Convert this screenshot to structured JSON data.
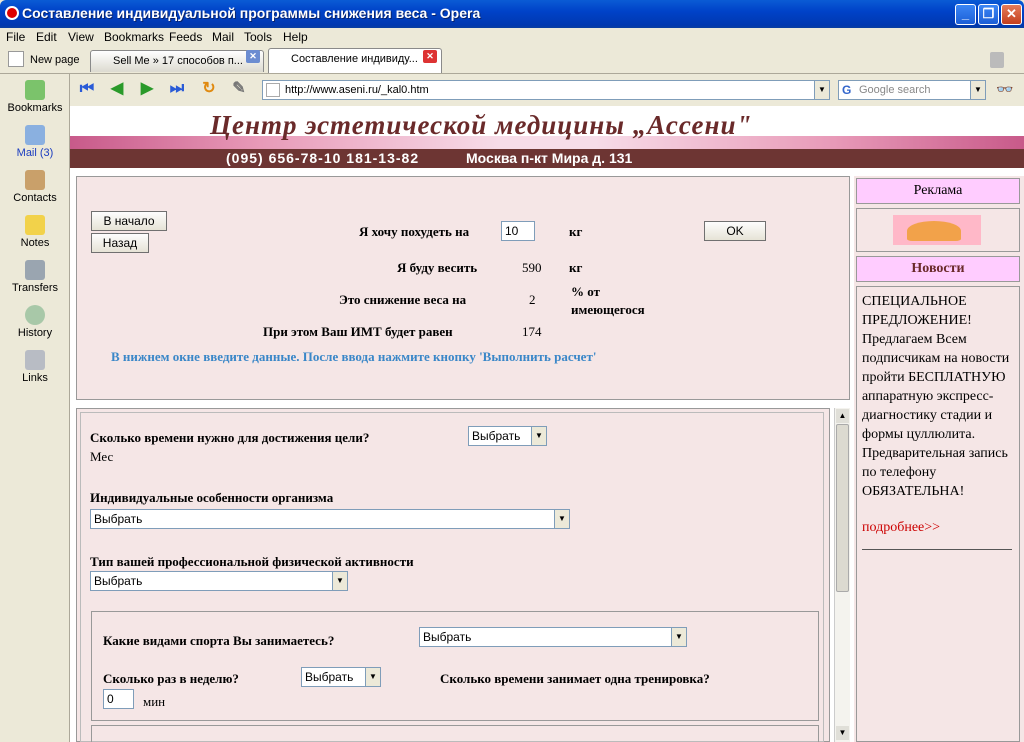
{
  "window": {
    "title": "Составление индивидуальной программы снижения веса - Opera"
  },
  "menu": [
    "File",
    "Edit",
    "View",
    "Bookmarks",
    "Feeds",
    "Mail",
    "Tools",
    "Help"
  ],
  "tabs": {
    "new_page": "New page",
    "items": [
      {
        "label": "Sell Me » 17 способов п..."
      },
      {
        "label": "Составление индивиду..."
      }
    ]
  },
  "nav": {
    "url": "http://www.aseni.ru/_kal0.htm",
    "search_placeholder": "Google search"
  },
  "sidepanel": [
    "Bookmarks",
    "Mail (3)",
    "Contacts",
    "Notes",
    "Transfers",
    "History",
    "Links"
  ],
  "header": {
    "title": "Центр эстетической медицины „Ассени\"",
    "phones": "(095) 656-78-10   181-13-82",
    "address": "Москва п-кт Мира д. 131"
  },
  "topform": {
    "btn_start": "В начало",
    "btn_back": "Назад",
    "want_lose_label": "Я хочу похудеть на",
    "want_lose_value": "10",
    "unit_kg": "кг",
    "ok": "OK",
    "will_weigh_label": "Я буду весить",
    "will_weigh_value": "590",
    "reduction_label": "Это снижение веса на",
    "reduction_value": "2",
    "reduction_unit": "% от имеющегося",
    "bmi_label": "При этом Ваш ИМТ будет равен",
    "bmi_value": "174",
    "hint": "В нижнем окне введите данные. После ввода нажмите кнопку 'Выполнить расчет'"
  },
  "lowerform": {
    "time_question": "Сколько времени нужно для достижения цели?",
    "time_select": "Выбрать",
    "time_unit": "Мес",
    "features_label": "Индивидуальные особенности организма",
    "features_select": "Выбрать",
    "activity_label": "Тип вашей профессиональной физической активности",
    "activity_select": "Выбрать",
    "sports_label": "Какие видами спорта Вы занимаетесь?",
    "sports_select": "Выбрать",
    "per_week_label": "Сколько раз в неделю?",
    "per_week_select": "Выбрать",
    "duration_label": "Сколько времени занимает одна тренировка?",
    "duration_value": "0",
    "duration_unit": "мин"
  },
  "rightcol": {
    "ads": "Реклама",
    "news_title": "Новости",
    "news_text": "СПЕЦИАЛЬНОЕ ПРЕДЛОЖЕНИЕ! Предлагаем Всем подписчикам на новости пройти БЕСПЛАТНУЮ аппаратную экспресс-диагностику стадии и формы цуллюлита. Предварительная запись по телефону ОБЯЗАТЕЛЬНА!",
    "more": "подробнее>>"
  }
}
